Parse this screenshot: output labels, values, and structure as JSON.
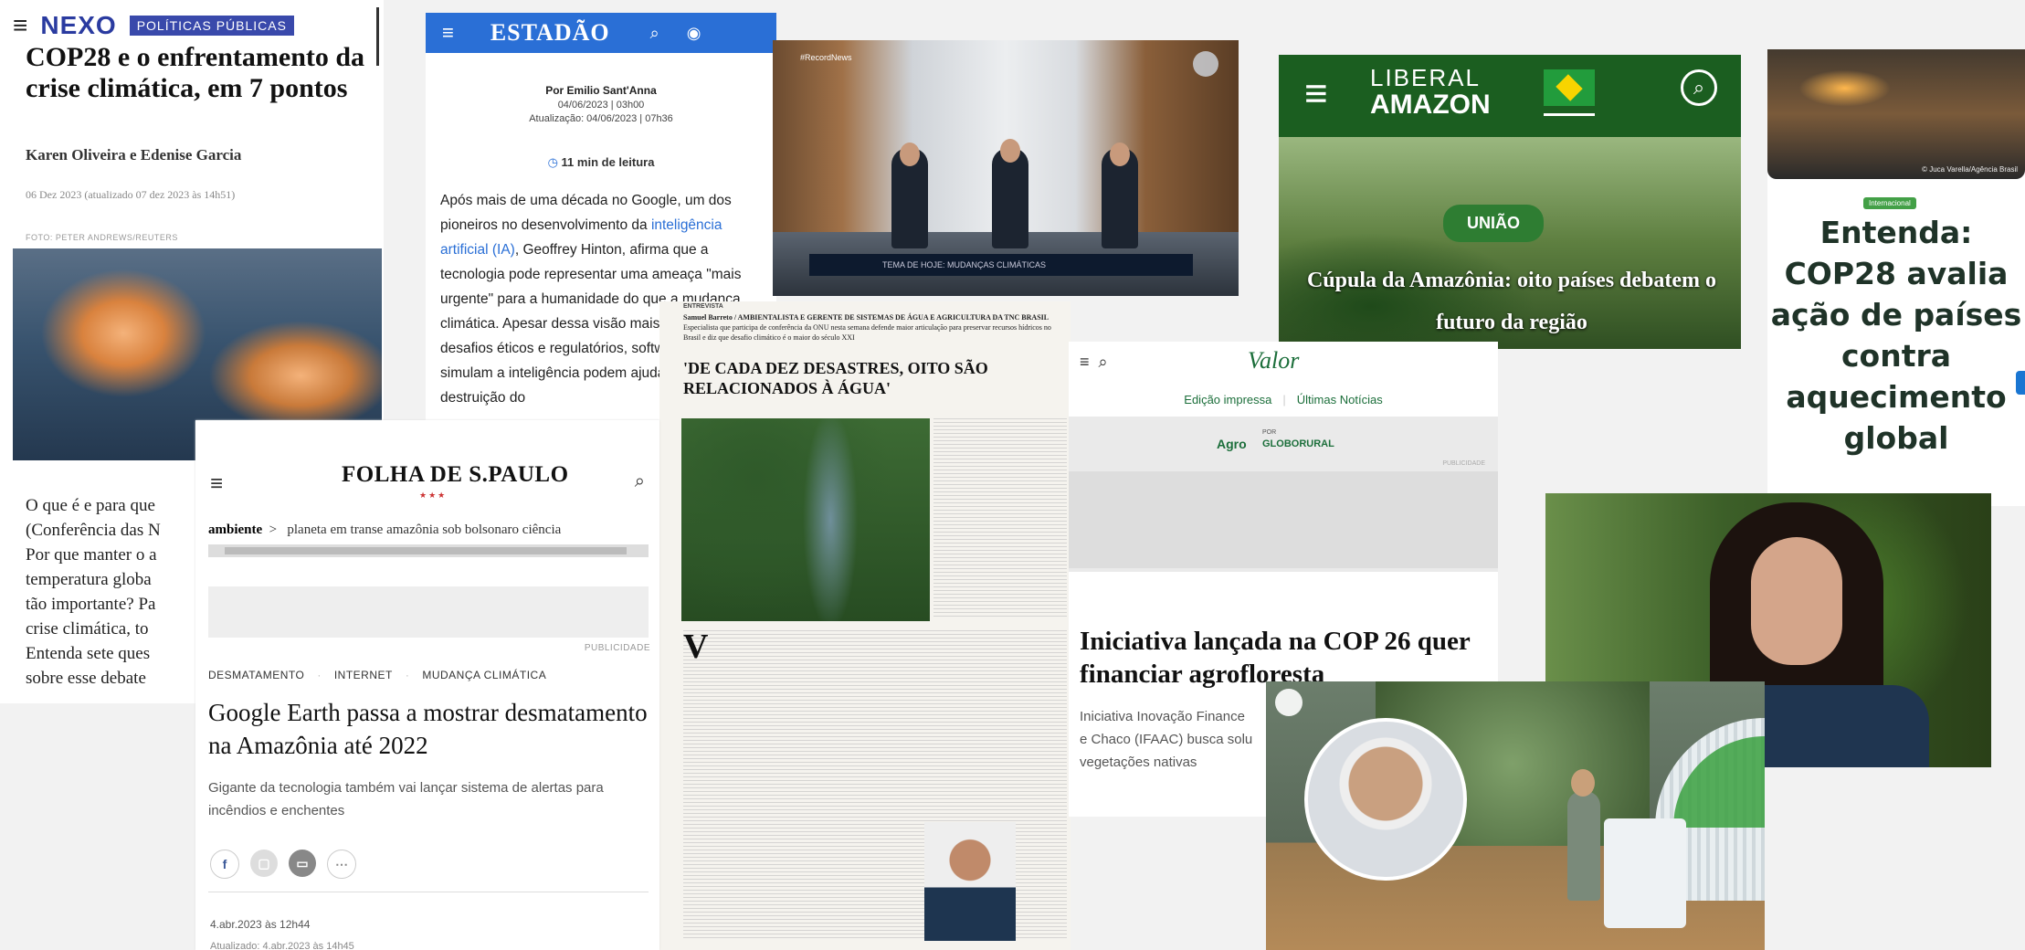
{
  "nexo": {
    "logo": "NEXO",
    "section": "POLÍTICAS PÚBLICAS",
    "title": "COP28 e o enfrentamento da crise climática, em 7 pontos",
    "authors": "Karen Oliveira e Edenise Garcia",
    "date": "06 Dez 2023 (atualizado 07 dez 2023 às 14h51)",
    "photo_credit": "FOTO: PETER ANDREWS/REUTERS",
    "body_lines": [
      "O que é e para que",
      "(Conferência das N",
      "Por que manter o a",
      "temperatura globa",
      "tão importante? Pa",
      "crise climática, to",
      "Entenda sete ques",
      "sobre esse debate"
    ]
  },
  "estadao": {
    "logo": "ESTADÃO",
    "byline": "Por Emilio Sant'Anna",
    "published": "04/06/2023 | 03h00",
    "updated": "Atualização: 04/06/2023 | 07h36",
    "read_time": "11 min de leitura",
    "text_1": "Após mais de uma década no Google, um dos pioneiros no desenvolvimento da ",
    "text_link": "inteligência artificial (IA)",
    "text_2": ", Geoffrey Hinton, afirma que a tecnologia pode representar uma ameaça \"mais urgente\" para a humanidade do que a mudança climática. Apesar dessa visão mais pe todos os desafios éticos e regulatórios, softwares que simulam a inteligência podem ajudar a frear a destruição do"
  },
  "record": {
    "tag": "#RecordNews",
    "lower_third": "TEMA DE HOJE: MUDANÇAS CLIMÁTICAS"
  },
  "liberal": {
    "logo_line1": "LIBERAL",
    "logo_line2": "AMAZON",
    "pill": "UNIÃO",
    "headline": "Cúpula da Amazônia: oito países debatem o futuro da região"
  },
  "entenda": {
    "photo_credit": "© Juca Varella/Agência Brasil",
    "badge": "Internacional",
    "title": "Entenda: COP28 avalia ação de países contra aquecimento global"
  },
  "folha": {
    "logo": "FOLHA DE S.PAULO",
    "stars": "★★★",
    "nav": {
      "active": "ambiente",
      "items": "planeta em transe    amazônia sob bolsonaro    ciência"
    },
    "ad_label": "PUBLICIDADE",
    "tags": [
      "DESMATAMENTO",
      "INTERNET",
      "MUDANÇA CLIMÁTICA"
    ],
    "title": "Google Earth passa a mostrar desmatamento na Amazônia até 2022",
    "subtitle": "Gigante da tecnologia também vai lançar sistema de alertas para incêndios e enchentes",
    "date": "4.abr.2023 às 12h44",
    "updated": "Atualizado: 4.abr.2023 às 14h45"
  },
  "paper": {
    "section": "ENTREVISTA",
    "author": "Samuel Barreto / AMBIENTALISTA E GERENTE DE SISTEMAS DE ÁGUA E AGRICULTURA DA TNC BRASIL",
    "author_desc": "Especialista que participa de conferência da ONU nesta semana defende maior articulação para preservar recursos hídricos no Brasil e diz que desafio climático é o maior do século XXI",
    "headline": "'DE CADA DEZ DESASTRES, OITO SÃO RELACIONADOS À ÁGUA'",
    "dropcap": "V"
  },
  "valor": {
    "logo": "Valor",
    "link1": "Edição impressa",
    "link2": "Últimas Notícias",
    "agro": "Agro",
    "por": "POR",
    "globo": "GLOBORURAL",
    "pub": "PUBLICIDADE",
    "title": "Iniciativa lançada na COP 26 quer financiar agrofloresta",
    "subtitle_lines": [
      "Iniciativa Inovação Finance",
      "e Chaco (IFAAC) busca solu",
      "vegetações nativas"
    ]
  },
  "colors": {
    "estadao_blue": "#2a6fd6",
    "liberal_green": "#1b5e20",
    "nexo_blue": "#2a3ba0",
    "valor_green": "#1b6e3a"
  }
}
